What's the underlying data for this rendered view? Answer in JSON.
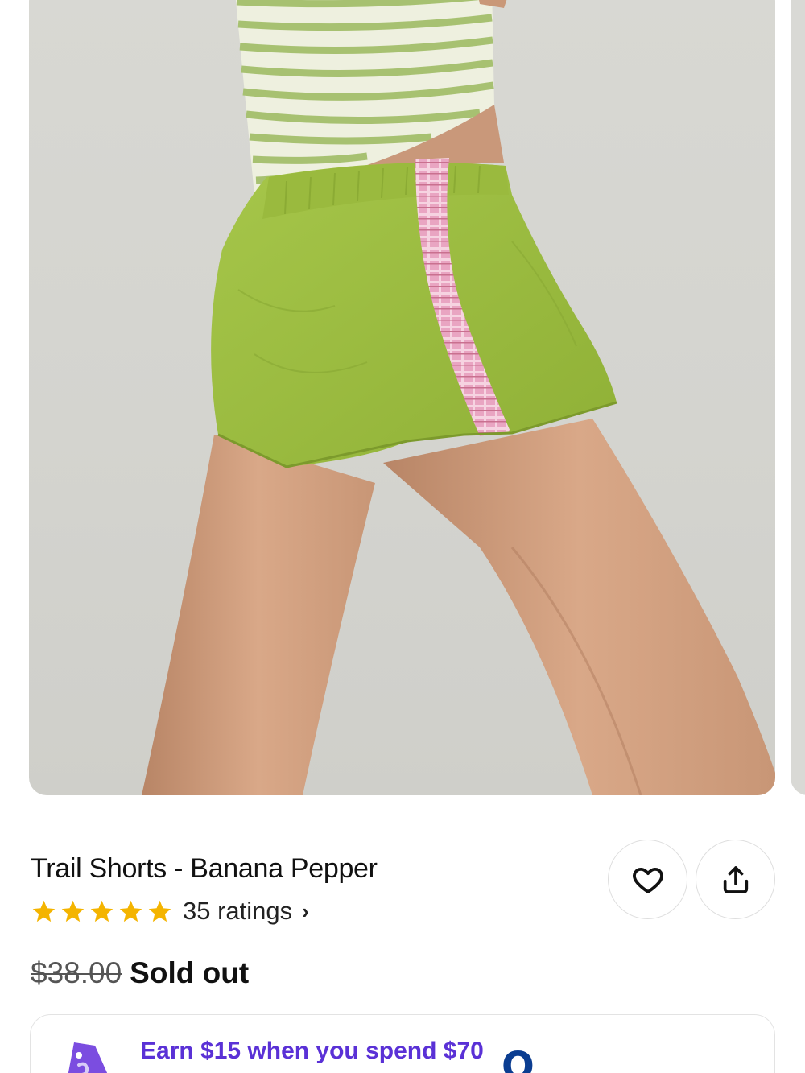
{
  "product": {
    "title": "Trail Shorts - Banana Pepper",
    "rating": {
      "stars": 5,
      "max_stars": 5,
      "ratings_label": "35 ratings",
      "chevron": "›"
    },
    "price": {
      "original": "$38.00",
      "status": "Sold out"
    }
  },
  "actions": {
    "favorite_icon": "heart-icon",
    "share_icon": "share-icon"
  },
  "promo": {
    "text": "Earn $15 when you spend $70",
    "icon": "price-tag-icon",
    "logo_glyph": "O"
  },
  "colors": {
    "star": "#f4b400",
    "promo_text": "#5a31d6",
    "promo_tag": "#7b4de0",
    "shorts": "#9cbd3f",
    "side_panel": "#e8a3c0"
  }
}
